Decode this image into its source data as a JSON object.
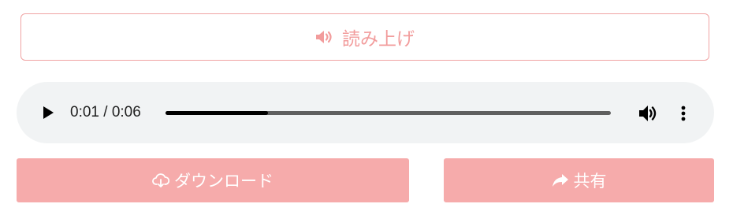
{
  "read_aloud": {
    "label": "読み上げ",
    "icon": "volume-up-icon",
    "color": "#f29c9c"
  },
  "player": {
    "current_time": "0:01",
    "duration": "0:06",
    "time_text": "0:01 / 0:06",
    "progress": 0.23,
    "background": "#f1f3f4"
  },
  "download": {
    "label": "ダウンロード",
    "icon": "cloud-download-icon"
  },
  "share": {
    "label": "共有",
    "icon": "share-arrow-icon"
  },
  "colors": {
    "accent": "#f6abab",
    "outline": "#f0a3a3"
  }
}
